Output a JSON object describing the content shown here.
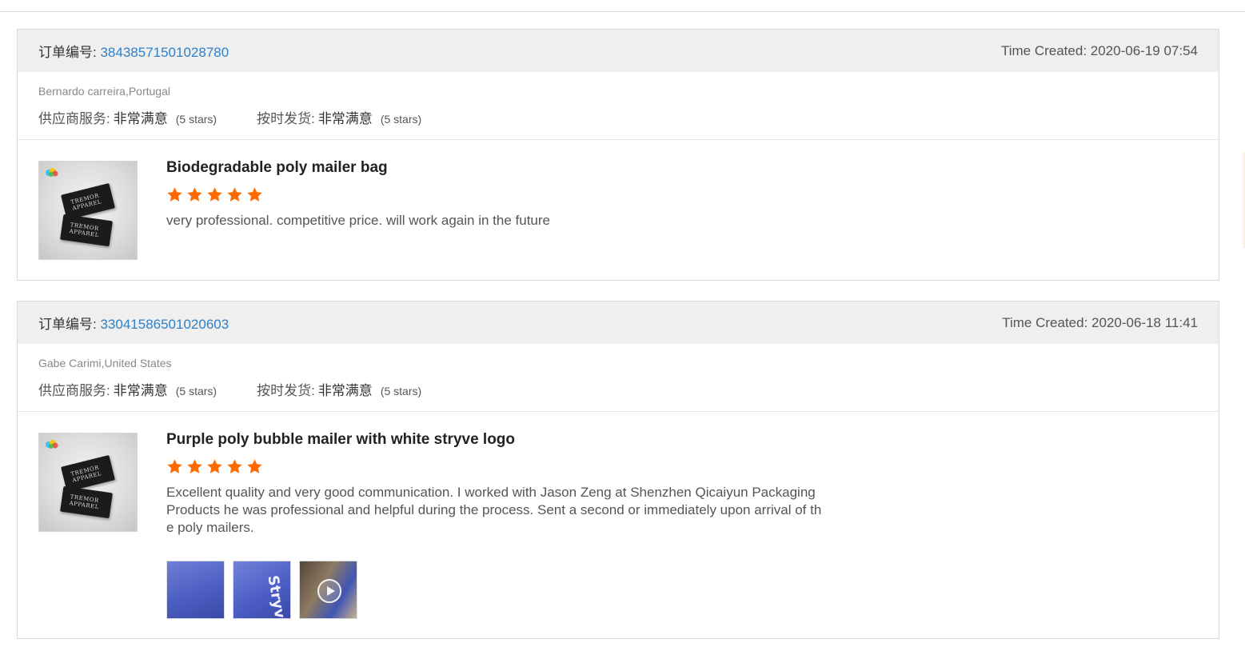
{
  "reviews": [
    {
      "order_label": "订单编号:",
      "order_number": "38438571501028780",
      "time_created": "Time Created: 2020-06-19 07:54",
      "buyer": "Bernardo carreira,Portugal",
      "supplier_service_label": "供应商服务:",
      "supplier_service_value": "非常满意",
      "supplier_service_stars": "(5 stars)",
      "on_time_label": "按时发货:",
      "on_time_value": "非常满意",
      "on_time_stars": "(5 stars)",
      "product_title": "Biodegradable poly mailer bag",
      "rating": 5,
      "review_text": "very professional. competitive price. will work again in the future",
      "thumb_text_1": "TREMOR APPAREL",
      "thumb_text_2": "TREMOR APPAREL"
    },
    {
      "order_label": "订单编号:",
      "order_number": "33041586501020603",
      "time_created": "Time Created: 2020-06-18 11:41",
      "buyer": "Gabe Carimi,United States",
      "supplier_service_label": "供应商服务:",
      "supplier_service_value": "非常满意",
      "supplier_service_stars": "(5 stars)",
      "on_time_label": "按时发货:",
      "on_time_value": "非常满意",
      "on_time_stars": "(5 stars)",
      "product_title": "Purple poly bubble mailer with white stryve logo",
      "rating": 5,
      "review_text": "Excellent quality and very good communication. I worked with Jason Zeng at Shenzhen Qicaiyun Packaging Products he was professional and helpful during the process. Sent a second or immediately upon arrival of the poly mailers.",
      "thumb_text_1": "TREMOR APPAREL",
      "thumb_text_2": "TREMOR APPAREL",
      "attachments": [
        {
          "type": "photo",
          "icon": "photo-icon"
        },
        {
          "type": "photo",
          "icon": "photo-icon",
          "text": "Stryve"
        },
        {
          "type": "video",
          "icon": "play-icon"
        }
      ]
    }
  ],
  "colors": {
    "header_bg": "#efefef",
    "link": "#2f80c7",
    "star": "#ff6a00",
    "border": "#dadada"
  }
}
